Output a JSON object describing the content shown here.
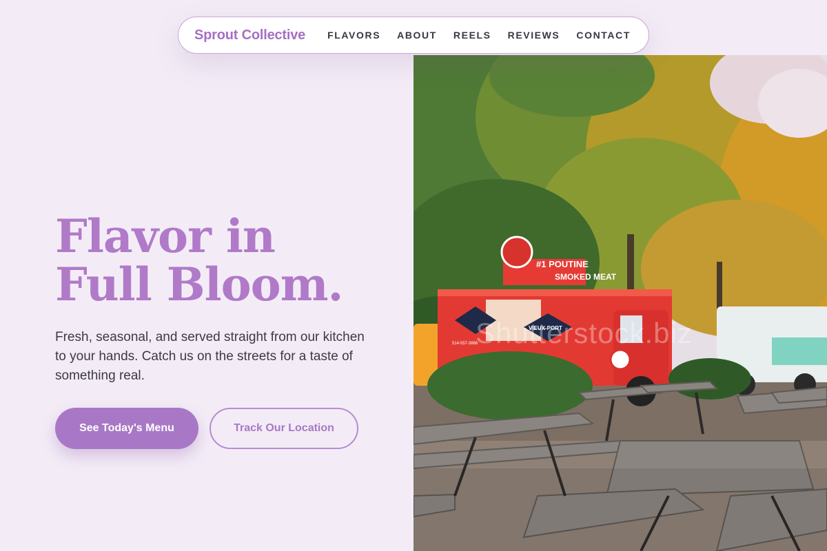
{
  "nav": {
    "brand": "Sprout Collective",
    "links": [
      {
        "label": "FLAVORS"
      },
      {
        "label": "ABOUT"
      },
      {
        "label": "REELS"
      },
      {
        "label": "REVIEWS"
      },
      {
        "label": "CONTACT"
      }
    ]
  },
  "hero": {
    "title_line1": "Flavor in",
    "title_line2": "Full Bloom.",
    "subtitle": "Fresh, seasonal, and served straight from our kitchen to your hands. Catch us on the streets for a taste of something real.",
    "primary_button": "See Today's Menu",
    "secondary_button": "Track Our Location"
  },
  "image": {
    "truck_sign": "#1 POUTINE",
    "truck_sign_2": "SMOKED MEAT",
    "truck_brand": "VIEUX-PORT",
    "truck_phone": "514-557-3866",
    "watermark": "Shutterstock.biz"
  },
  "colors": {
    "accent": "#a878c6",
    "brand": "#a66fc4",
    "background": "#f3ecf6",
    "text": "#3d3a45"
  }
}
